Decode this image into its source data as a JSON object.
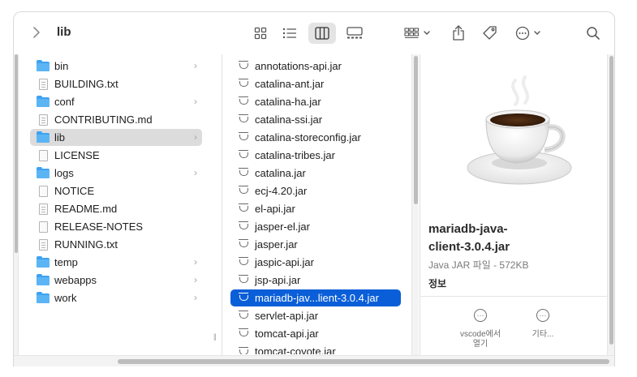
{
  "toolbar": {
    "title": "lib",
    "back_icon": "chevron-right-icon"
  },
  "sidebar": {
    "items": [
      {
        "label": "bin",
        "kind": "folder",
        "chevron": true
      },
      {
        "label": "BUILDING.txt",
        "kind": "doc-lines",
        "chevron": false
      },
      {
        "label": "conf",
        "kind": "folder",
        "chevron": true
      },
      {
        "label": "CONTRIBUTING.md",
        "kind": "doc-lines",
        "chevron": false
      },
      {
        "label": "lib",
        "kind": "folder",
        "chevron": true,
        "selected": true
      },
      {
        "label": "LICENSE",
        "kind": "doc",
        "chevron": false
      },
      {
        "label": "logs",
        "kind": "folder",
        "chevron": true
      },
      {
        "label": "NOTICE",
        "kind": "doc",
        "chevron": false
      },
      {
        "label": "README.md",
        "kind": "doc-lines",
        "chevron": false
      },
      {
        "label": "RELEASE-NOTES",
        "kind": "doc",
        "chevron": false
      },
      {
        "label": "RUNNING.txt",
        "kind": "doc-lines",
        "chevron": false
      },
      {
        "label": "temp",
        "kind": "folder",
        "chevron": true
      },
      {
        "label": "webapps",
        "kind": "folder",
        "chevron": true
      },
      {
        "label": "work",
        "kind": "folder",
        "chevron": true
      }
    ]
  },
  "files": {
    "items": [
      {
        "label": "annotations-api.jar"
      },
      {
        "label": "catalina-ant.jar"
      },
      {
        "label": "catalina-ha.jar"
      },
      {
        "label": "catalina-ssi.jar"
      },
      {
        "label": "catalina-storeconfig.jar"
      },
      {
        "label": "catalina-tribes.jar"
      },
      {
        "label": "catalina.jar"
      },
      {
        "label": "ecj-4.20.jar"
      },
      {
        "label": "el-api.jar"
      },
      {
        "label": "jasper-el.jar"
      },
      {
        "label": "jasper.jar"
      },
      {
        "label": "jaspic-api.jar"
      },
      {
        "label": "jsp-api.jar"
      },
      {
        "label": "mariadb-jav...lient-3.0.4.jar",
        "selected": true
      },
      {
        "label": "servlet-api.jar"
      },
      {
        "label": "tomcat-api.jar"
      },
      {
        "label": "tomcat-coyote.jar"
      }
    ]
  },
  "preview": {
    "name_line1": "mariadb-java-",
    "name_line2": "client-3.0.4.jar",
    "info": "Java JAR 파일 - 572KB",
    "more_label": "정보",
    "actions": [
      {
        "label_line1": "vscode에서",
        "label_line2": "열기",
        "icon": "ellipsis-circle-icon"
      },
      {
        "label_line1": "기타...",
        "label_line2": "",
        "icon": "ellipsis-circle-icon"
      }
    ]
  },
  "colors": {
    "selection_blue": "#0a5fd8",
    "folder_blue": "#3ea2f0",
    "sidebar_selected_gray": "#dcdcdc"
  }
}
